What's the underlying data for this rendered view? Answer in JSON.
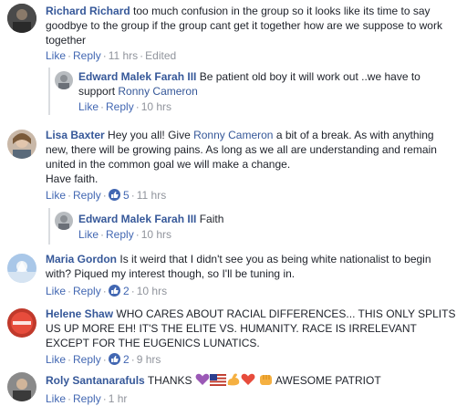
{
  "comments": [
    {
      "author": "Richard Richard",
      "text": "too much confusion in the group so it looks like its time to say goodbye to the group if the group cant get it together how are we suppose to work together",
      "like": "Like",
      "reply": "Reply",
      "time": "11 hrs",
      "edited": "Edited"
    },
    {
      "author": "Edward Malek Farah III",
      "text": "Be patient old boy it will work out ..we have to support",
      "mention": "Ronny Cameron",
      "like": "Like",
      "reply": "Reply",
      "time": "10 hrs"
    },
    {
      "author": "Lisa Baxter",
      "text_before": "Hey you all! Give",
      "mention": "Ronny Cameron",
      "text_after": "a bit of a break. As with anything new, there will be growing pains. As long as we all are understanding and remain united in the common goal we will make a change.",
      "text_last": "Have faith.",
      "like": "Like",
      "reply": "Reply",
      "likes": "5",
      "time": "11 hrs"
    },
    {
      "author": "Edward Malek Farah III",
      "text": "Faith",
      "like": "Like",
      "reply": "Reply",
      "time": "10 hrs"
    },
    {
      "author": "Maria Gordon",
      "text": "Is it weird that I didn't see you as being white nationalist to begin with? Piqued my interest though, so I'll be tuning in.",
      "like": "Like",
      "reply": "Reply",
      "likes": "2",
      "time": "10 hrs"
    },
    {
      "author": "Helene Shaw",
      "text": "WHO CARES ABOUT RACIAL DIFFERENCES... THIS ONLY SPLITS US UP MORE EH! IT'S THE ELITE VS. HUMANITY. RACE IS IRRELEVANT EXCEPT FOR THE EUGENICS LUNATICS.",
      "like": "Like",
      "reply": "Reply",
      "likes": "2",
      "time": "9 hrs"
    },
    {
      "author": "Roly Santanarafuls",
      "text_before": "THANKS",
      "text_after": "AWESOME PATRIOT",
      "emojis": [
        "purple-heart-emoji",
        "us-flag-emoji",
        "flexed-biceps-emoji",
        "heart-emoji",
        "fist-emoji"
      ],
      "like": "Like",
      "reply": "Reply",
      "time": "1 hr"
    }
  ],
  "separator": "·",
  "colors": {
    "link": "#365899",
    "action": "#4267b2",
    "meta": "#90949c",
    "text": "#1d2129",
    "bar": "#dadde1"
  }
}
